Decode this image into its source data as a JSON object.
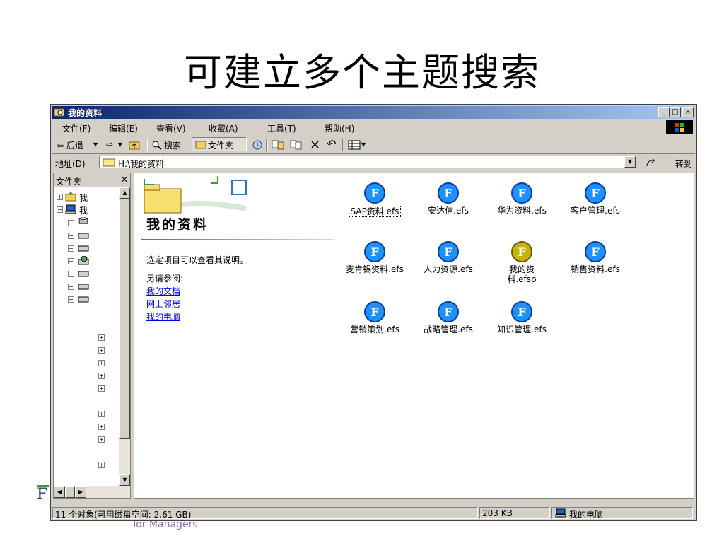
{
  "slide": {
    "title": "可建立多个主题搜索",
    "logo_letter": "F",
    "footer_text": "Tor Managers"
  },
  "window": {
    "title": "我的资料",
    "buttons": {
      "minimize": "_",
      "maximize": "□",
      "close": "×"
    },
    "menu": [
      "文件(F)",
      "编辑(E)",
      "查看(V)",
      "收藏(A)",
      "工具(T)",
      "帮助(H)"
    ],
    "toolbar": {
      "back": "⇦ 后退",
      "back_drop": "▾",
      "forward": "⇨",
      "forward_drop": "▾",
      "search": "搜索",
      "folders": "文件夹",
      "delete": "×",
      "undo": "↶",
      "views_drop": "▾"
    },
    "address": {
      "label": "地址(D)",
      "path": "H:\\我的资料",
      "go": "转到"
    },
    "folders_pane": {
      "title": "文件夹",
      "close": "×",
      "items": [
        "我",
        "我"
      ]
    },
    "webview": {
      "folder_name": "我的资料",
      "hint": "选定项目可以查看其说明。",
      "see_also": "另请参阅:",
      "links": [
        "我的文档",
        "网上邻居",
        "我的电脑"
      ]
    },
    "files": [
      {
        "name": "SAP资料.efs",
        "color": "#1e90ff"
      },
      {
        "name": "安达信.efs",
        "color": "#1e90ff"
      },
      {
        "name": "华为资料.efs",
        "color": "#1e90ff"
      },
      {
        "name": "客户管理.efs",
        "color": "#1e90ff"
      },
      {
        "name": "麦肯锡资料.efs",
        "color": "#1e90ff"
      },
      {
        "name": "人力资源.efs",
        "color": "#1e90ff"
      },
      {
        "name": "我的资料.efsp",
        "color": "#c8b400"
      },
      {
        "name": "销售资料.efs",
        "color": "#1e90ff"
      },
      {
        "name": "营销策划.efs",
        "color": "#1e90ff"
      },
      {
        "name": "战略管理.efs",
        "color": "#1e90ff"
      },
      {
        "name": "知识管理.efs",
        "color": "#1e90ff"
      }
    ],
    "file_icon_letter": "F",
    "status": {
      "objects": "11 个对象(可用磁盘空间: 2.61 GB)",
      "size": "203 KB",
      "location": "我的电脑"
    }
  }
}
